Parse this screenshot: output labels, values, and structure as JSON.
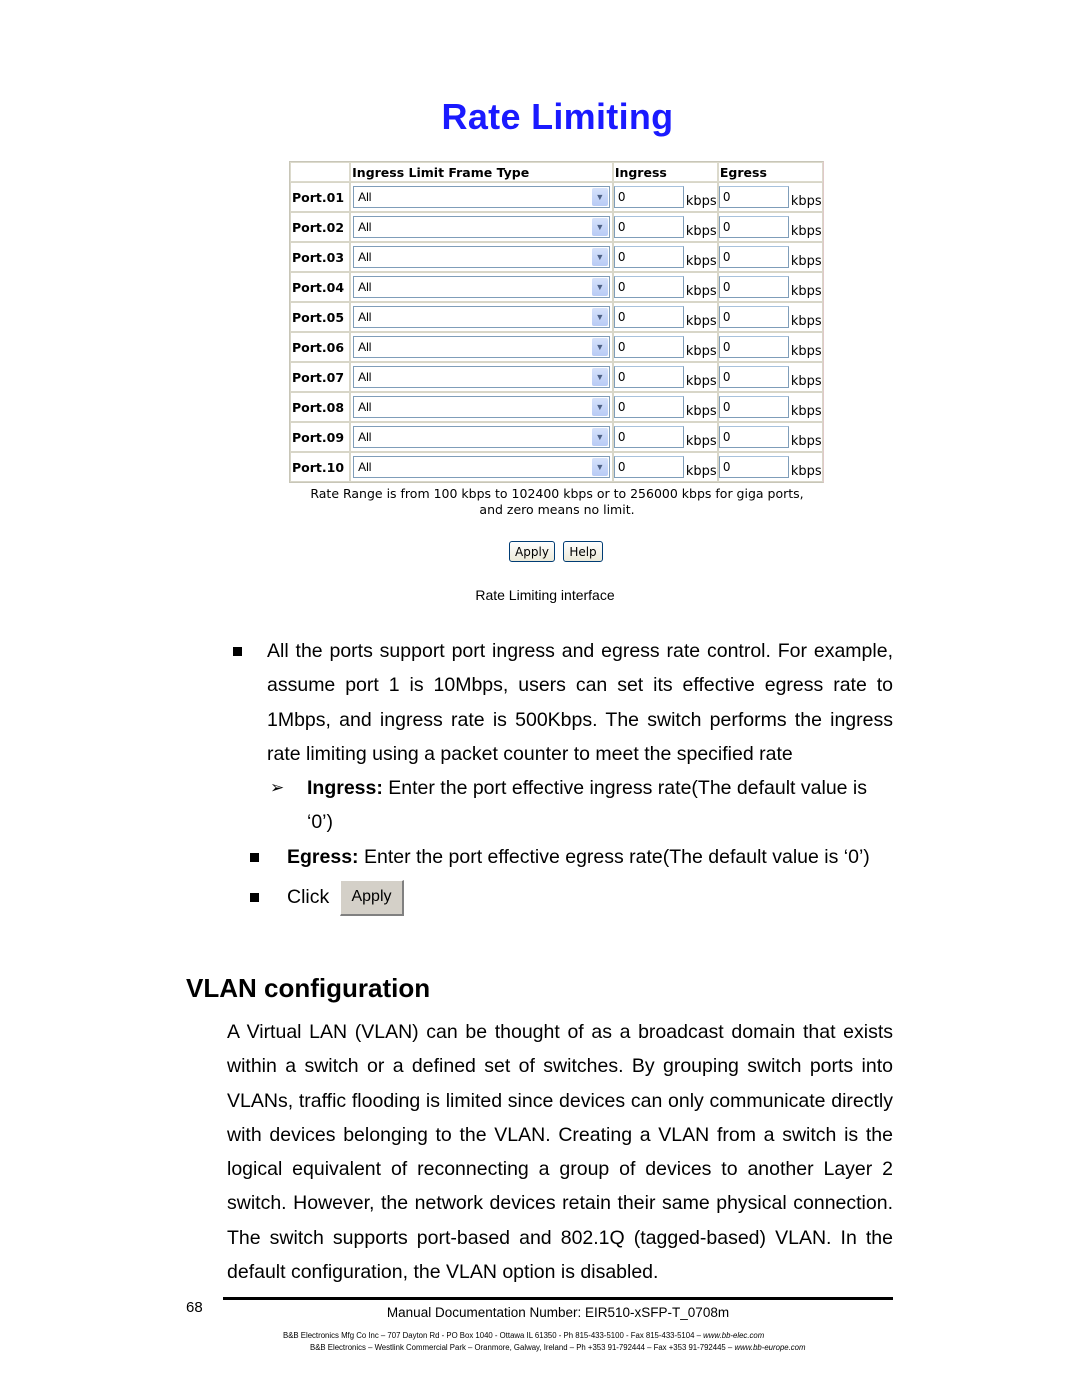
{
  "ui": {
    "title": "Rate Limiting",
    "accent_color": "#1a1aff",
    "headers": [
      "",
      "Ingress Limit Frame Type",
      "Ingress",
      "Egress"
    ],
    "rows": [
      {
        "port": "Port.01",
        "frame_type": "All",
        "ingress": "0",
        "egress": "0"
      },
      {
        "port": "Port.02",
        "frame_type": "All",
        "ingress": "0",
        "egress": "0"
      },
      {
        "port": "Port.03",
        "frame_type": "All",
        "ingress": "0",
        "egress": "0"
      },
      {
        "port": "Port.04",
        "frame_type": "All",
        "ingress": "0",
        "egress": "0"
      },
      {
        "port": "Port.05",
        "frame_type": "All",
        "ingress": "0",
        "egress": "0"
      },
      {
        "port": "Port.06",
        "frame_type": "All",
        "ingress": "0",
        "egress": "0"
      },
      {
        "port": "Port.07",
        "frame_type": "All",
        "ingress": "0",
        "egress": "0"
      },
      {
        "port": "Port.08",
        "frame_type": "All",
        "ingress": "0",
        "egress": "0"
      },
      {
        "port": "Port.09",
        "frame_type": "All",
        "ingress": "0",
        "egress": "0"
      },
      {
        "port": "Port.10",
        "frame_type": "All",
        "ingress": "0",
        "egress": "0"
      }
    ],
    "unit": "kbps",
    "dropdown_icon": "chevron-down-icon",
    "note_line1": "Rate Range is from 100 kbps to 102400 kbps or to 256000 kbps for giga ports,",
    "note_line2": "and zero means no limit.",
    "apply_label": "Apply",
    "help_label": "Help"
  },
  "caption": "Rate Limiting interface",
  "bullets": {
    "b1": "All the ports support port ingress and egress rate control. For example, assume port 1 is 10Mbps, users can set its effective egress rate to 1Mbps, and ingress rate is 500Kbps. The switch performs the ingress rate limiting using a packet counter to meet the specified rate",
    "ingress_label": "Ingress:",
    "ingress_text": " Enter the port effective ingress rate(The default value is",
    "ingress_text2": "‘0’)",
    "egress_label": "Egress:",
    "egress_text": " Enter the port effective egress rate(The default value is ‘0’)",
    "click_label": "Click",
    "click_button": "Apply"
  },
  "section": {
    "heading": "VLAN configuration",
    "paragraph": "A Virtual LAN (VLAN) can be thought of as a broadcast domain that exists within a switch or a defined set of switches. By grouping switch ports into VLANs, traffic flooding is limited since devices can only communicate directly with devices belonging to the VLAN. Creating a VLAN from a switch is the logical equivalent of reconnecting a group of devices to another Layer 2 switch. However, the network devices retain their same physical connection. The switch supports port-based and 802.1Q (tagged-based) VLAN. In the default configuration, the VLAN option is disabled."
  },
  "footer": {
    "page_number": "68",
    "doc_number": "Manual Documentation Number: EIR510-xSFP-T_0708m",
    "line1": "B&B Electronics Mfg Co Inc – 707 Dayton Rd - PO Box 1040 - Ottawa IL 61350 - Ph 815-433-5100 - Fax 815-433-5104 – ",
    "line1_url": "www.bb-elec.com",
    "line2": "B&B Electronics – Westlink Commercial Park – Oranmore, Galway, Ireland – Ph +353 91-792444 – Fax +353 91-792445 – ",
    "line2_url": "www.bb-europe.com"
  }
}
